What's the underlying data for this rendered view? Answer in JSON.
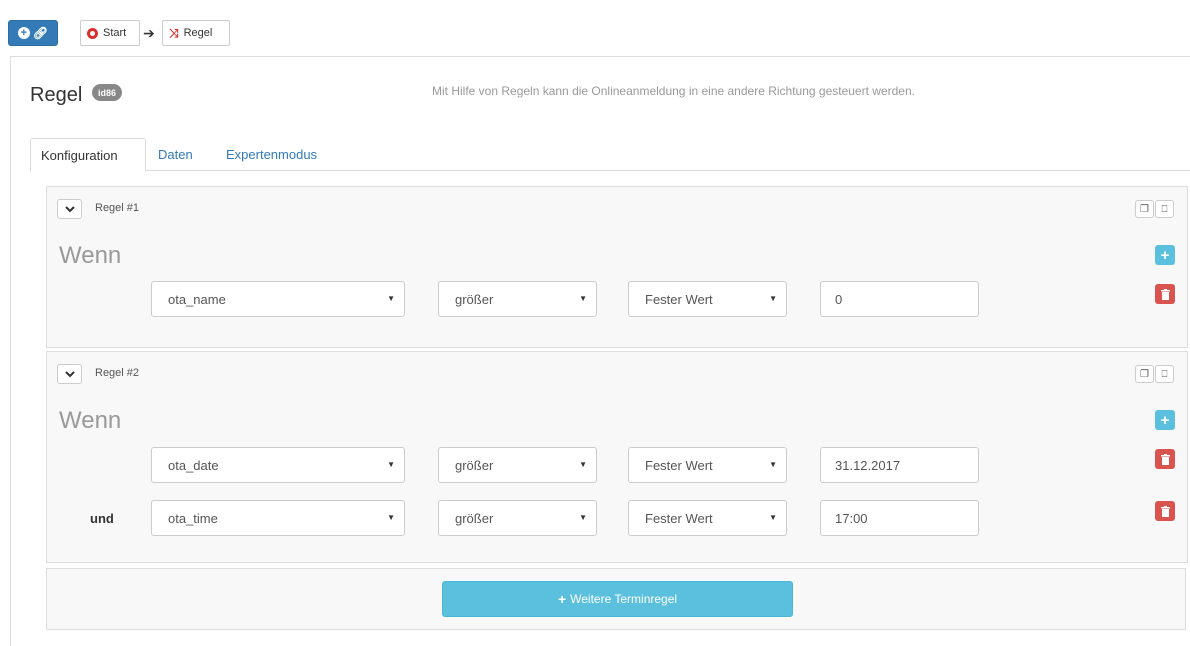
{
  "toolbar": {
    "add_icon": "plus-circle-icon",
    "breadcrumb": [
      {
        "label": "Start",
        "icon": "start-circle-icon",
        "icon_color": "#d9302c"
      },
      {
        "label": "Regel",
        "icon": "shuffle-icon",
        "icon_color": "#d9302c"
      }
    ]
  },
  "header": {
    "title": "Regel",
    "id_badge": "id86",
    "description": "Mit Hilfe von Regeln kann die Onlineanmeldung in eine andere Richtung gesteuert werden."
  },
  "tabs": [
    {
      "label": "Konfiguration",
      "active": true
    },
    {
      "label": "Daten",
      "active": false
    },
    {
      "label": "Expertenmodus",
      "active": false
    }
  ],
  "rules": [
    {
      "label": "Regel #1",
      "condition_heading": "Wenn",
      "conditions": [
        {
          "connector": "",
          "field": "ota_name",
          "operator": "größer",
          "value_type": "Fester Wert",
          "value": "0"
        }
      ]
    },
    {
      "label": "Regel #2",
      "condition_heading": "Wenn",
      "conditions": [
        {
          "connector": "",
          "field": "ota_date",
          "operator": "größer",
          "value_type": "Fester Wert",
          "value": "31.12.2017"
        },
        {
          "connector": "und",
          "field": "ota_time",
          "operator": "größer",
          "value_type": "Fester Wert",
          "value": "17:00"
        }
      ]
    }
  ],
  "footer": {
    "add_rule_label": "Weitere Terminregel"
  },
  "colors": {
    "primary": "#337ab7",
    "info": "#5bc0de",
    "danger": "#d9534f",
    "link": "#337ab7"
  }
}
